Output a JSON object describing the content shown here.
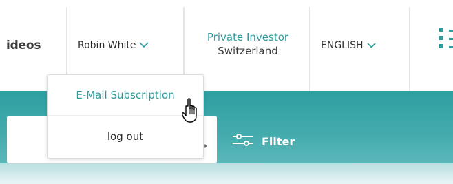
{
  "nav": {
    "videos_label": "ideos",
    "user_name": "Robin White",
    "investor_line1": "Private Investor",
    "investor_line2": "Switzerland",
    "language": "ENGLISH"
  },
  "dropdown": {
    "items": [
      {
        "label": "E-Mail Subscription"
      },
      {
        "label": "log out"
      }
    ]
  },
  "search": {
    "filter_label": "Filter"
  },
  "colors": {
    "accent": "#2d9a9c",
    "hero_top": "#2e9fa1",
    "hero_bottom": "#6fc1c3",
    "text_dark": "#2f2f2f"
  },
  "icons": [
    "chevron-down-icon",
    "grid-menu-icon",
    "filter-sliders-icon",
    "hand-pointer-cursor-icon",
    "search-icon"
  ]
}
